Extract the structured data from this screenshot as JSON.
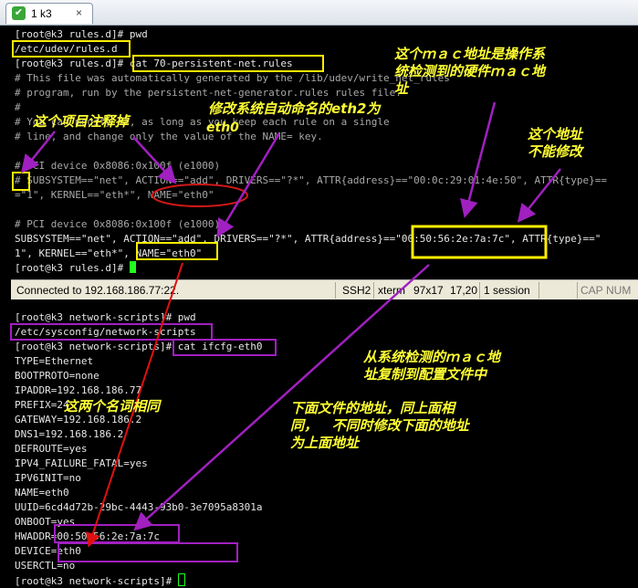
{
  "tab": {
    "check": "✔",
    "label": "1 k3",
    "close": "×"
  },
  "terminal_top": {
    "lines": [
      "[root@k3 rules.d]# pwd",
      "/etc/udev/rules.d",
      "[root@k3 rules.d]# cat 70-persistent-net.rules",
      "# This file was automatically generated by the /lib/udev/write_net_rules",
      "# program, run by the persistent-net-generator.rules rules file.",
      "#",
      "# You can modify it, as long as you keep each rule on a single",
      "# line, and change only the value of the NAME= key.",
      "",
      "# PCI device 0x8086:0x100f (e1000)",
      "# SUBSYSTEM==\"net\", ACTION==\"add\", DRIVERS==\"?*\", ATTR{address}==\"00:0c:29:01:4e:50\", ATTR{type}==",
      "=\"1\", KERNEL==\"eth*\", NAME=\"eth0\"",
      "",
      "# PCI device 0x8086:0x100f (e1000)",
      "SUBSYSTEM==\"net\", ACTION==\"add\", DRIVERS==\"?*\", ATTR{address}==\"00:50:56:2e:7a:7c\", ATTR{type}==\"",
      "1\", KERNEL==\"eth*\", NAME=\"eth0\"",
      "[root@k3 rules.d]# "
    ]
  },
  "status_bar": {
    "connection": "Connected to 192.168.186.77:22.",
    "protocol": "SSH2",
    "terminal_type": "xterm",
    "size": "97x17",
    "position": "17,20",
    "sessions": "1 session",
    "caps": "CAP",
    "num": "NUM"
  },
  "terminal_bottom": {
    "lines": [
      "[root@k3 network-scripts]# pwd",
      "/etc/sysconfig/network-scripts",
      "[root@k3 network-scripts]# cat ifcfg-eth0",
      "TYPE=Ethernet",
      "BOOTPROTO=none",
      "IPADDR=192.168.186.77",
      "PREFIX=24",
      "GATEWAY=192.168.186.2",
      "DNS1=192.168.186.2",
      "DEFROUTE=yes",
      "IPV4_FAILURE_FATAL=yes",
      "IPV6INIT=no",
      "NAME=eth0",
      "UUID=6cd4d72b-29bc-4443-93b0-3e7095a8301a",
      "ONBOOT=yes",
      "HWADDR=00:50:56:2e:7a:7c",
      "DEVICE=eth0",
      "USERCTL=no",
      "[root@k3 network-scripts]# "
    ]
  },
  "annotations": {
    "mac_detected": "这个ｍａｃ地址是操作系\n统检测到的硬件ｍａｃ地\n址",
    "rename_eth2": "修改系统自动命名的eth2为",
    "eth0": "eth0",
    "comment_out": "这个项目注释掉",
    "cannot_modify": "这个地址\n不能修改",
    "copy_mac": "从系统检测的ｍａｃ地\n址复制到配置文件中",
    "same_names": "这两个名词相同",
    "file_address": "下面文件的地址，同上面相\n同，   不同时修改下面的地址\n为上面地址"
  },
  "colors": {
    "annotation_text": "#ffff33",
    "yellow_box": "#ffee00",
    "purple_box": "#a020c0",
    "red_mark": "#e01010",
    "cursor": "#20ff20"
  }
}
